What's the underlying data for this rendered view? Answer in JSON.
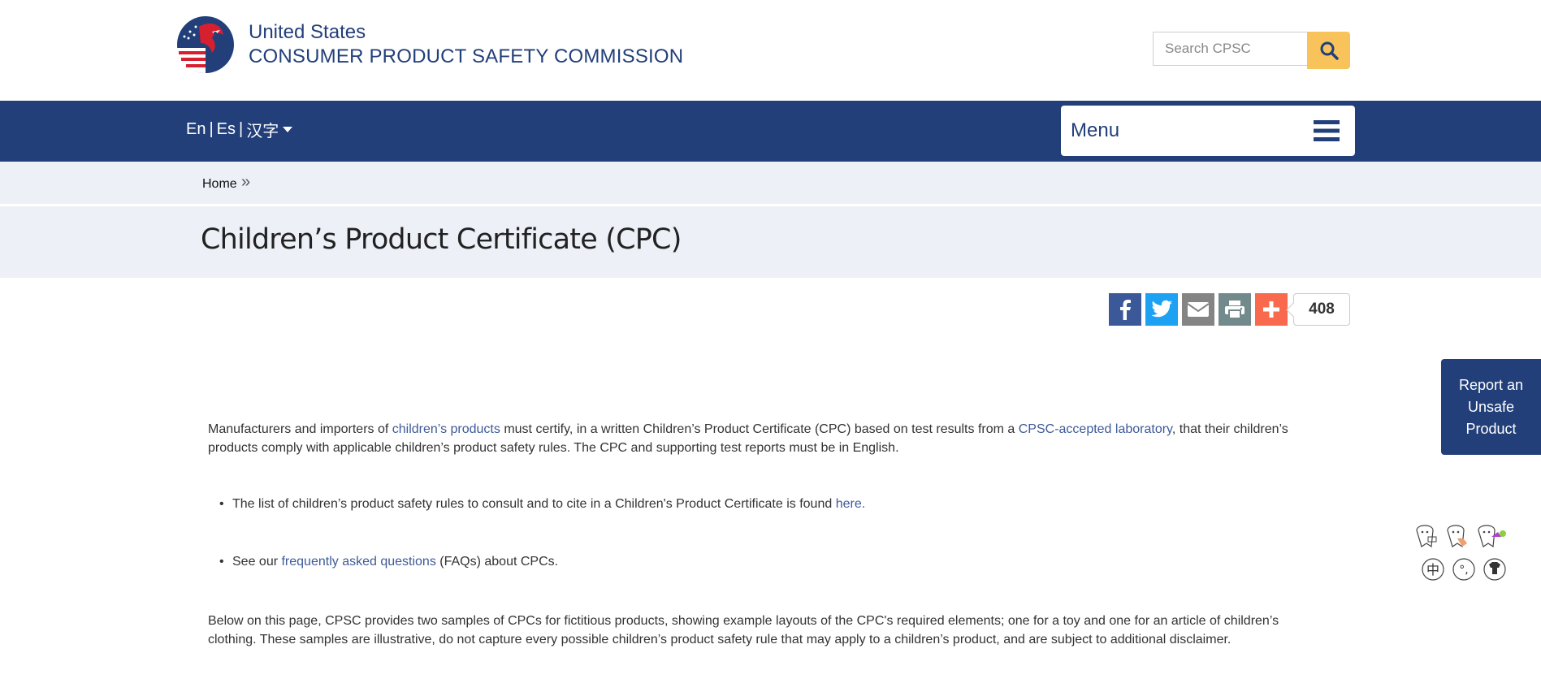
{
  "header": {
    "brand_top": "United States",
    "brand_bottom": "CONSUMER PRODUCT SAFETY COMMISSION",
    "search_placeholder": "Search CPSC",
    "search_icon": "search-icon"
  },
  "nav": {
    "lang_en": "En",
    "lang_es": "Es",
    "lang_zh": "汉字",
    "menu_label": "Menu"
  },
  "breadcrumb": {
    "home": "Home",
    "separator": "»"
  },
  "page": {
    "title": "Children’s Product Certificate (CPC)"
  },
  "share": {
    "count": "408",
    "buttons": [
      "facebook-icon",
      "twitter-icon",
      "email-icon",
      "print-icon",
      "plus-icon"
    ]
  },
  "report_tab": {
    "line1": "Report an",
    "line2": "Unsafe",
    "line3": "Product"
  },
  "content": {
    "p1_a": "Manufacturers and importers of ",
    "p1_link1": "children’s products",
    "p1_b": " must certify, in a written Children’s Product Certificate (CPC) based on test results from a ",
    "p1_link2": "CPSC-accepted laboratory",
    "p1_c": ", that their children’s products comply with applicable children’s product safety rules.   The CPC and supporting test reports must be in English.",
    "b1_a": "The list of children’s product safety rules to consult and to cite in a Children's Product Certificate is found ",
    "b1_link": "here.",
    "b2_a": "See our ",
    "b2_link": "frequently asked questions",
    "b2_b": " (FAQs) about CPCs.",
    "p2": "Below on this page, CPSC provides two samples of CPCs for fictitious products, showing example layouts of the CPC's required elements; one for a toy and one for an article of children’s clothing. These samples are illustrative, do not capture every possible children’s product safety rule that may apply to a children’s product, and are subject to additional disclaimer."
  },
  "colors": {
    "navy": "#223f7a",
    "search_button": "#f8c35a",
    "band": "#edf0f7",
    "facebook": "#3b5998",
    "twitter": "#1da1f2",
    "email": "#848484",
    "print": "#738a8d",
    "plus": "#f8694d"
  }
}
